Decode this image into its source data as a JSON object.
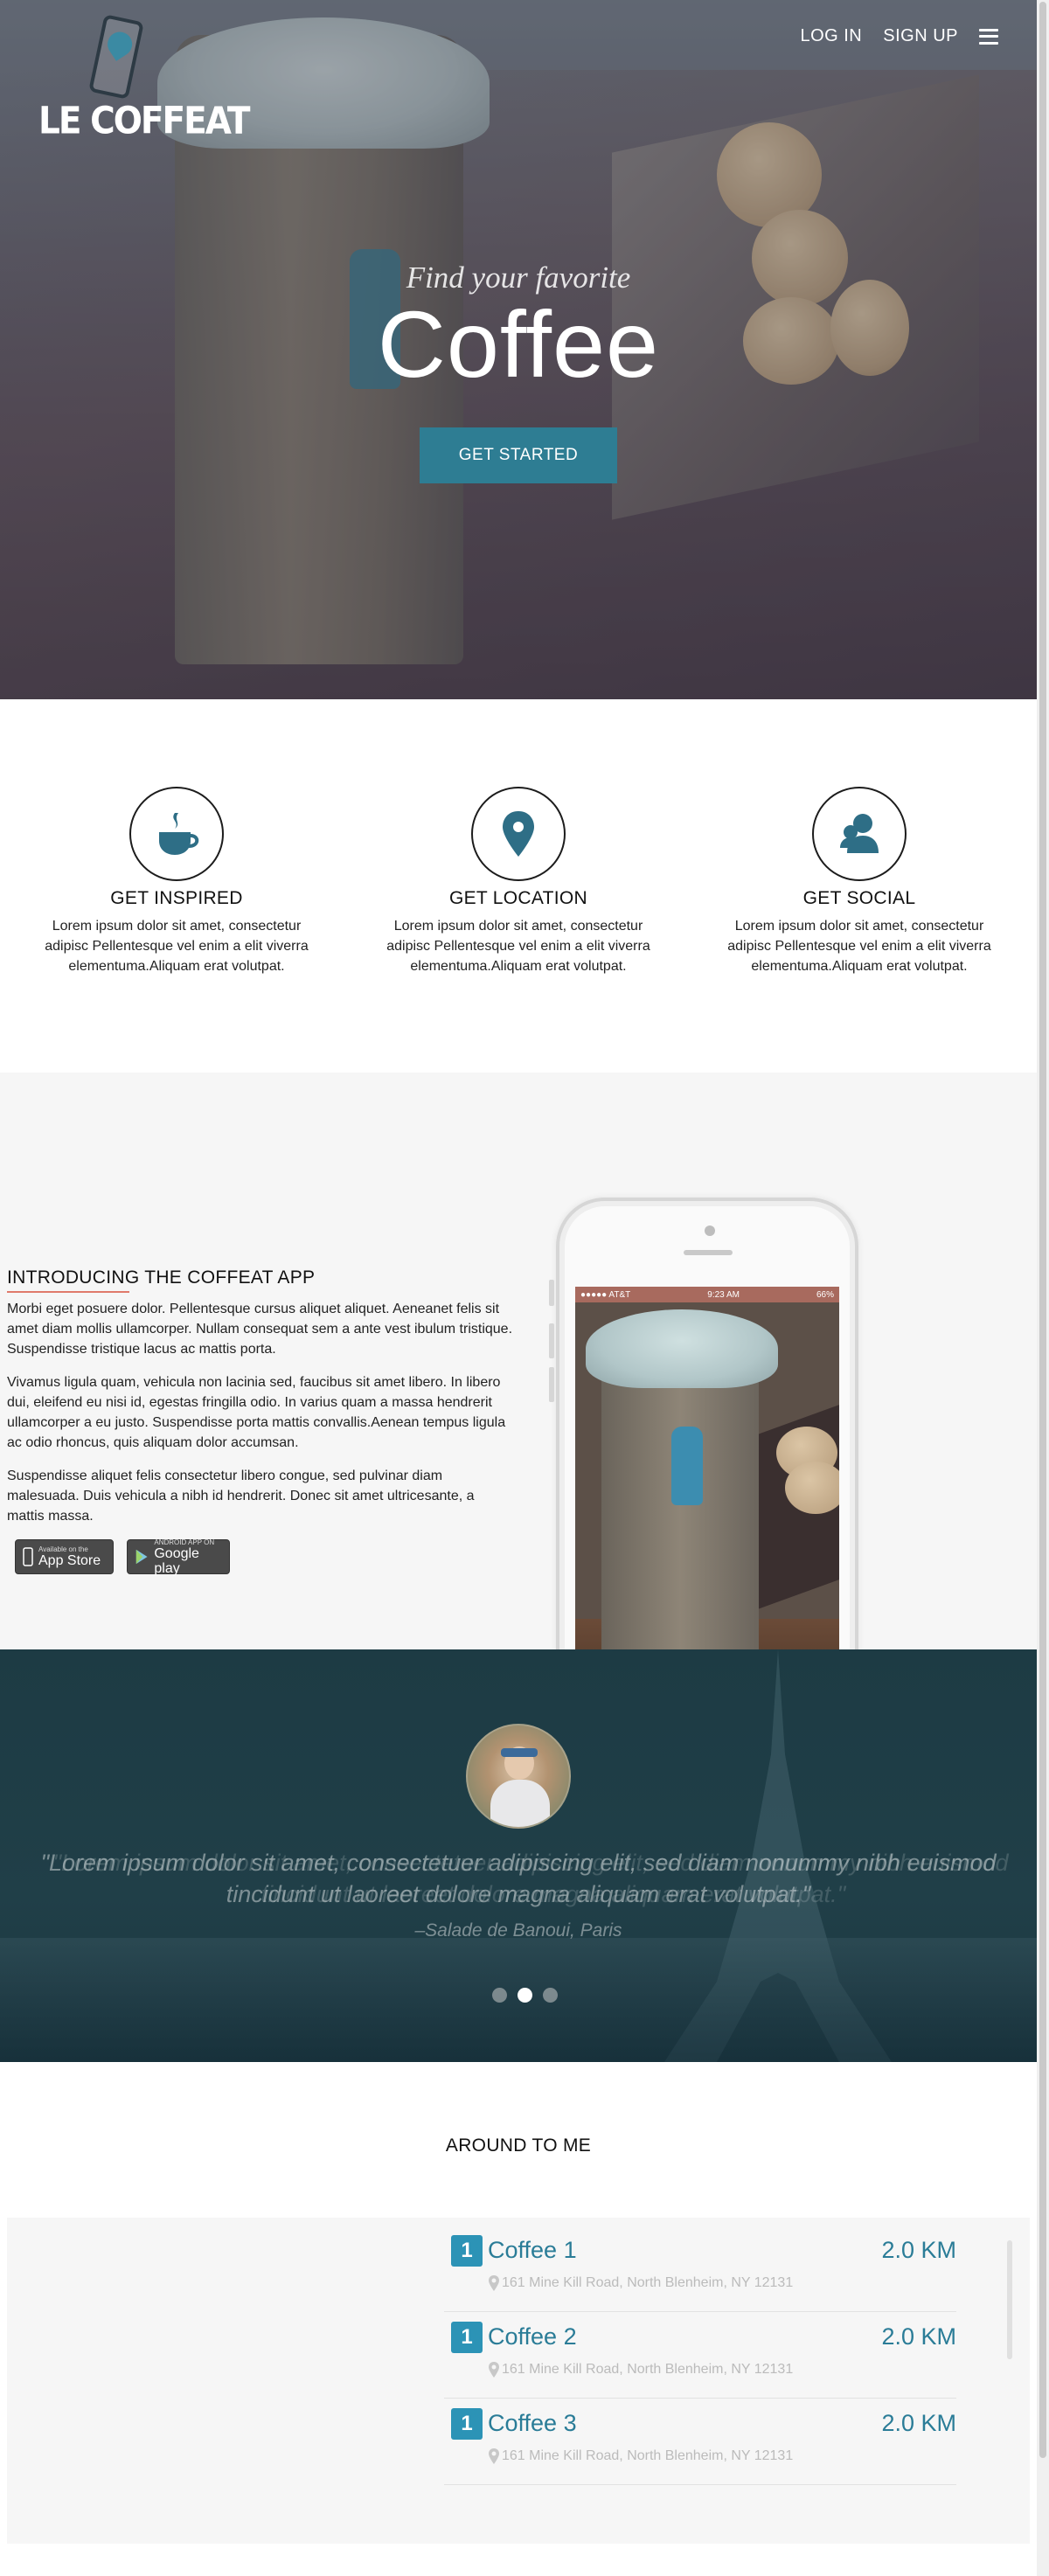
{
  "brand": {
    "name": "LE COFFEAT"
  },
  "nav": {
    "login": "LOG IN",
    "signup": "SIGN UP"
  },
  "hero": {
    "subtitle": "Find your favorite",
    "title": "Coffee",
    "cta": "GET STARTED"
  },
  "features": [
    {
      "title": "GET INSPIRED",
      "text": "Lorem ipsum dolor sit amet, consectetur adipisc Pellentesque vel enim a elit viverra elementuma.Aliquam erat volutpat.",
      "icon": "coffee-cup-icon"
    },
    {
      "title": "GET LOCATION",
      "text": "Lorem ipsum dolor sit amet, consectetur adipisc Pellentesque vel enim a elit viverra elementuma.Aliquam erat volutpat.",
      "icon": "location-pin-icon"
    },
    {
      "title": "GET SOCIAL",
      "text": "Lorem ipsum dolor sit amet, consectetur adipisc Pellentesque vel enim a elit viverra elementuma.Aliquam erat volutpat.",
      "icon": "people-icon"
    }
  ],
  "app": {
    "title": "INTRODUCING THE COFFEAT APP",
    "paragraphs": [
      "Morbi eget posuere dolor. Pellentesque cursus aliquet aliquet. Aeneanet felis sit amet diam mollis ullamcorper. Nullam consequat sem a ante vest ibulum tristique. Suspendisse tristique lacus ac mattis porta.",
      "Vivamus ligula quam, vehicula non lacinia sed, faucibus sit amet libero. In libero dui, eleifend eu nisi id, egestas fringilla odio. In varius quam a massa hendrerit ullamcorper a eu justo. Suspendisse porta mattis convallis.Aenean tempus ligula ac odio rhoncus, quis aliquam dolor accumsan.",
      "Suspendisse aliquet felis consectetur libero congue, sed pulvinar diam malesuada. Duis vehicula a nibh id hendrerit. Donec sit amet ultricesante, a mattis massa."
    ],
    "appstore": {
      "small": "Available on the",
      "big": "App Store"
    },
    "googleplay": {
      "small": "ANDROID APP ON",
      "big": "Google play"
    },
    "phone_status": {
      "carrier": "●●●●● AT&T",
      "time": "9:23 AM",
      "battery": "66%"
    }
  },
  "testimonial": {
    "quote_line1": "\"Lorem ipsum dolor sit amet, consectetuer adipiscing elit, sed diam nonummy nibh euismod",
    "quote_line2": "tincidunt ut laoreet dolore magna aliquam erat volutpat.\"",
    "author": "–Salade de Banoui, Paris",
    "slide_count": 3,
    "active_slide": 2
  },
  "around": {
    "title": "AROUND TO ME",
    "items": [
      {
        "rank": "1",
        "name": "Coffee 1",
        "distance": "2.0 KM",
        "address": "161 Mine Kill Road, North Blenheim, NY 12131"
      },
      {
        "rank": "1",
        "name": "Coffee 2",
        "distance": "2.0 KM",
        "address": "161 Mine Kill Road, North Blenheim, NY 12131"
      },
      {
        "rank": "1",
        "name": "Coffee 3",
        "distance": "2.0 KM",
        "address": "161 Mine Kill Road, North Blenheim, NY 12131"
      }
    ]
  },
  "colors": {
    "accent": "#2e7d93",
    "title_underline": "#e07a6b",
    "list_accent": "#2c93b6",
    "testimonial_bg": "#1d3b44"
  }
}
